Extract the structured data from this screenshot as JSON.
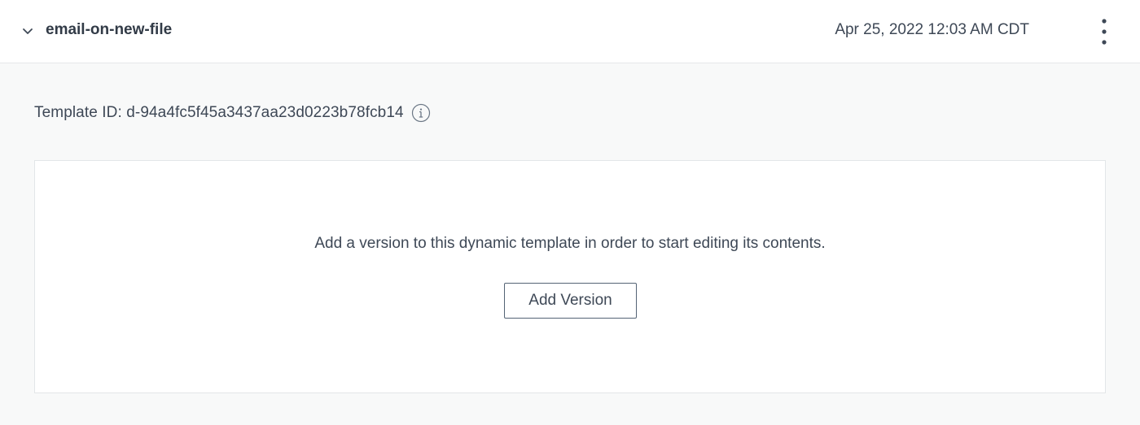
{
  "header": {
    "template_name": "email-on-new-file",
    "timestamp": "Apr 25, 2022 12:03 AM CDT",
    "expand_icon": "chevron-down-icon",
    "menu_icon": "kebab-menu-icon"
  },
  "template": {
    "id_text": "Template ID: d-94a4fc5f45a3437aa23d0223b78fcb14",
    "info_icon": "info-icon"
  },
  "empty_state": {
    "message": "Add a version to this dynamic template in order to start editing its contents.",
    "button_label": "Add Version"
  },
  "colors": {
    "background": "#f8f9f9",
    "surface": "#ffffff",
    "text": "#3e4856",
    "border": "#e3e6e8",
    "button_border": "#546375"
  }
}
